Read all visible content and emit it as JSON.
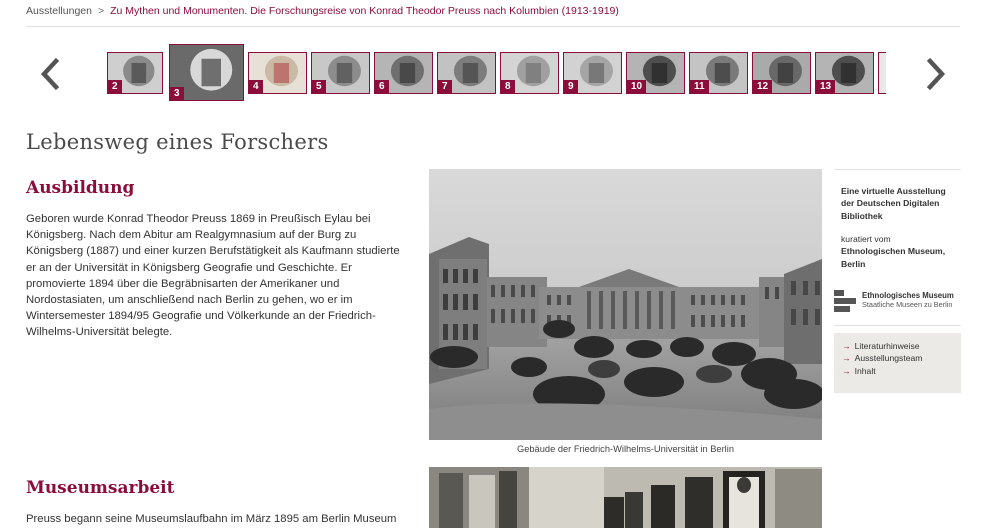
{
  "breadcrumb": {
    "home": "Ausstellungen",
    "separator": ">",
    "current": "Zu Mythen und Monumenten. Die Forschungsreise von Konrad Theodor Preuss nach Kolumbien (1913-1919)"
  },
  "carousel": {
    "thumbnails": [
      {
        "number": "2",
        "subject": "portrait"
      },
      {
        "number": "3",
        "subject": "museum-vitrine",
        "active": true
      },
      {
        "number": "4",
        "subject": "map"
      },
      {
        "number": "5",
        "subject": "ship"
      },
      {
        "number": "6",
        "subject": "stone-face"
      },
      {
        "number": "7",
        "subject": "stone-carving"
      },
      {
        "number": "8",
        "subject": "stone-relief"
      },
      {
        "number": "9",
        "subject": "landscape"
      },
      {
        "number": "10",
        "subject": "face"
      },
      {
        "number": "11",
        "subject": "group"
      },
      {
        "number": "12",
        "subject": "people"
      },
      {
        "number": "13",
        "subject": "face"
      }
    ]
  },
  "page": {
    "title": "Lebensweg eines Forschers"
  },
  "sections": {
    "ausbildung": {
      "heading": "Ausbildung",
      "lines": [
        "Geboren wurde Konrad Theodor Preuss 1869 in Preußisch Eylau bei",
        "Königsberg. Nach dem Abitur am Realgymnasium auf der Burg zu",
        "Königsberg (1887) und einer kurzen Berufstätigkeit als Kaufmann studierte",
        "er an der Universität in Königsberg Geografie und Geschichte. Er",
        "promovierte 1894 über die Begräbnisarten der Amerikaner und",
        "Nordostasiaten, um anschließend nach Berlin zu gehen, wo er im",
        "Wintersemester 1894/95 Geografie und Völkerkunde an der Friedrich-",
        "Wilhelms-Universität belegte."
      ],
      "caption": "Gebäude der Friedrich-Wilhelms-Universität in Berlin"
    },
    "museumsarbeit": {
      "heading": "Museumsarbeit",
      "lines": [
        "Preuss begann seine Museumslaufbahn im März 1895 am Berlin Museum"
      ]
    }
  },
  "sidebar": {
    "intro": [
      "Eine virtuelle Ausstellung",
      "der Deutschen Digitalen",
      "Bibliothek"
    ],
    "curated_label": "kuratiert vom",
    "curator": [
      "Ethnologischen Museum,",
      "Berlin"
    ],
    "logo": {
      "line1": "Ethnologisches Museum",
      "line2": "Staatliche Museen zu Berlin"
    },
    "links": [
      "Literaturhinweise",
      "Ausstellungsteam",
      "Inhalt"
    ]
  },
  "icons": {
    "prev": "chevron-left-icon",
    "next": "chevron-right-icon",
    "link": "arrow-right-icon"
  },
  "colors": {
    "accent": "#8b0d3a",
    "nav_arrow": "#555555",
    "sidebar_box": "#eceae6"
  }
}
